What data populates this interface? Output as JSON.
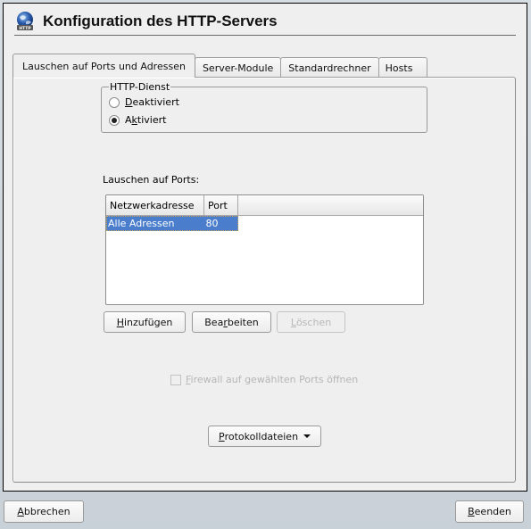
{
  "window": {
    "title": "Konfiguration des HTTP-Servers",
    "icon": "http-globe-icon"
  },
  "tabs": [
    {
      "label": "Lauschen auf Ports und Adressen",
      "active": true
    },
    {
      "label": "Server-Module",
      "active": false
    },
    {
      "label": "Standardrechner",
      "active": false
    },
    {
      "label": "Hosts",
      "active": false
    }
  ],
  "http_service": {
    "legend": "HTTP-Dienst",
    "options": [
      {
        "label_pre": "",
        "mnemonic": "D",
        "label_post": "eaktiviert",
        "checked": false
      },
      {
        "label_pre": "A",
        "mnemonic": "k",
        "label_post": "tiviert",
        "checked": true
      }
    ]
  },
  "ports": {
    "label": "Lauschen auf Ports:",
    "columns": [
      "Netzwerkadresse",
      "Port"
    ],
    "rows": [
      {
        "address": "Alle Adressen",
        "port": "80",
        "selected": true
      }
    ]
  },
  "buttons": {
    "add": {
      "mnemonic": "H",
      "rest": "inzufügen"
    },
    "edit": {
      "pre": "Bea",
      "mnemonic": "r",
      "rest": "beiten"
    },
    "delete": {
      "mnemonic": "L",
      "rest": "öschen",
      "disabled": true
    }
  },
  "firewall": {
    "mnemonic": "F",
    "rest": "irewall auf gewählten Ports öffnen",
    "checked": false,
    "disabled": true
  },
  "logfiles": {
    "mnemonic": "P",
    "rest": "rotokolldateien"
  },
  "footer": {
    "cancel": {
      "mnemonic": "A",
      "rest": "bbrechen"
    },
    "finish": {
      "mnemonic": "B",
      "rest": "eenden"
    }
  },
  "colors": {
    "selection": "#4a7dcc",
    "panel_bg": "#efefef"
  }
}
